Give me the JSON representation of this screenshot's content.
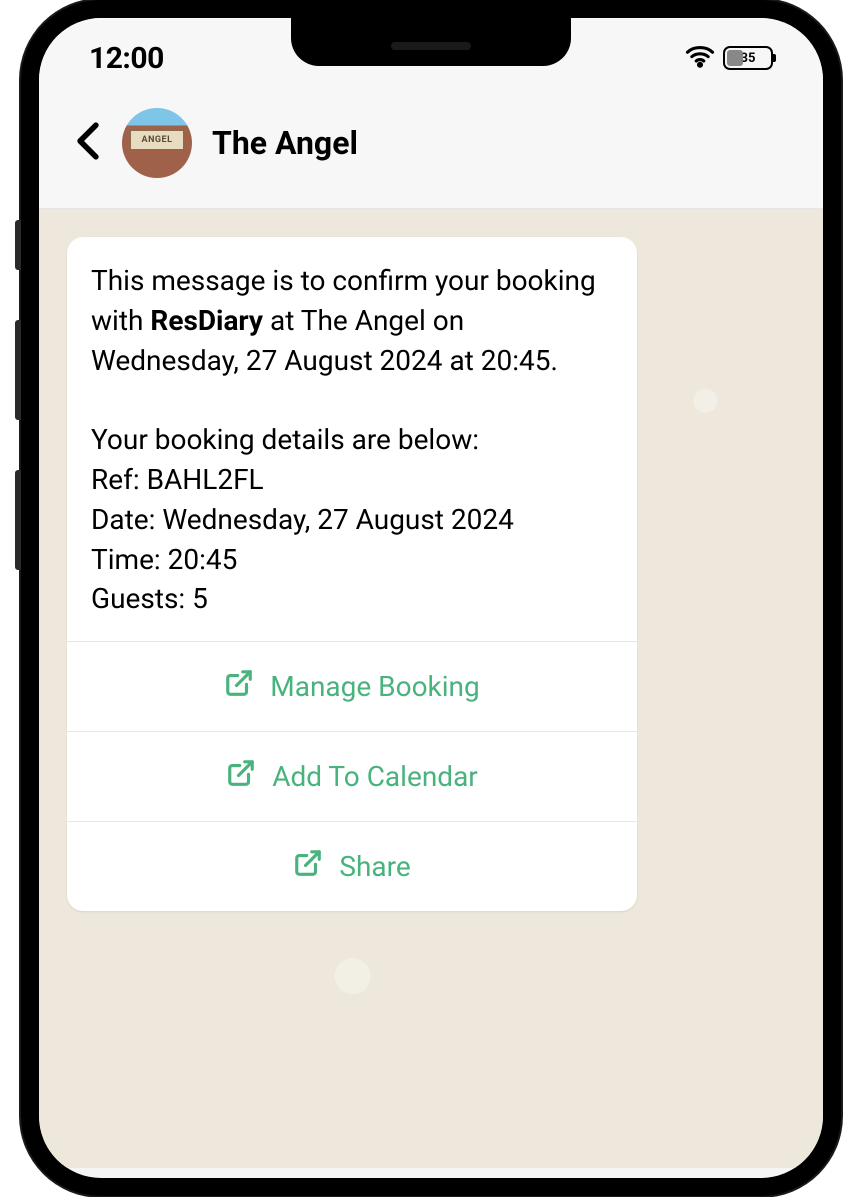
{
  "status": {
    "time": "12:00",
    "battery": "35"
  },
  "header": {
    "title": "The Angel",
    "avatar_text": "ANGEL"
  },
  "message": {
    "intro_prefix": "This message is to confirm your booking with ",
    "intro_bold": "ResDiary",
    "intro_suffix": " at The Angel on Wednesday, 27 August 2024 at 20:45.",
    "details_heading": "Your booking details are below:",
    "ref_label": "Ref: ",
    "ref": "BAHL2FL",
    "date_label": "Date: ",
    "date": "Wednesday, 27 August 2024",
    "time_label": "Time: ",
    "time": "20:45",
    "guests_label": "Guests: ",
    "guests": "5"
  },
  "actions": {
    "manage": "Manage Booking",
    "calendar": "Add To Calendar",
    "share": "Share"
  }
}
